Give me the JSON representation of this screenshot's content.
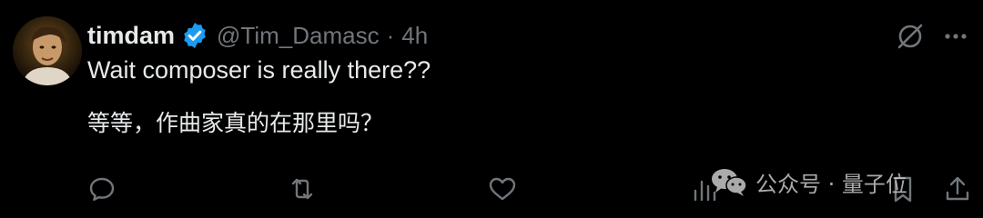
{
  "tweet": {
    "author": {
      "display_name": "timdam",
      "verified": true,
      "handle": "@Tim_Damasc",
      "separator": "·",
      "time": "4h"
    },
    "text_line_1": "Wait composer is really there??",
    "text_line_2": "等等，作曲家真的在那里吗？"
  },
  "actions": [
    "reply-icon",
    "retweet-icon",
    "like-icon",
    "views-icon",
    "bookmark-icon",
    "share-icon"
  ],
  "top_icons": [
    "grok-icon",
    "more-icon"
  ],
  "watermark": {
    "text": "公众号 · 量子位"
  },
  "colors": {
    "background": "#000000",
    "text": "#e7e9ea",
    "secondary": "#71767b",
    "verified": "#1d9bf0"
  }
}
